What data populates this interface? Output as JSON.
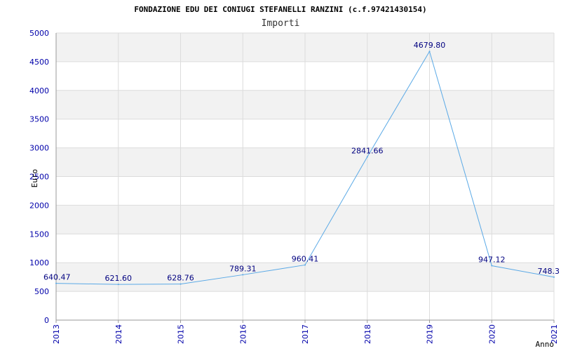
{
  "chart_data": {
    "type": "line",
    "title": "FONDAZIONE EDU DEI CONIUGI STEFANELLI RANZINI (c.f.97421430154)",
    "subtitle": "Importi",
    "xlabel": "Anno",
    "ylabel": "Euro",
    "categories": [
      "2013",
      "2014",
      "2015",
      "2016",
      "2017",
      "2018",
      "2019",
      "2020",
      "2021"
    ],
    "values": [
      640.47,
      621.6,
      628.76,
      789.31,
      960.41,
      2841.66,
      4679.8,
      947.12,
      748.3
    ],
    "value_labels": [
      "640.47",
      "621.60",
      "628.76",
      "789.31",
      "960.41",
      "2841.66",
      "4679.80",
      "947.12",
      "748.3"
    ],
    "ylim": [
      0,
      5000
    ],
    "yticks": [
      "0",
      "500",
      "1000",
      "1500",
      "2000",
      "2500",
      "3000",
      "3500",
      "4000",
      "4500",
      "5000"
    ],
    "grid": true,
    "colors": {
      "line": "#5aa9e6",
      "labels": "#000080",
      "ticks": "#0000aa",
      "band": "#f2f2f2",
      "grid": "#dcdcdc"
    }
  }
}
